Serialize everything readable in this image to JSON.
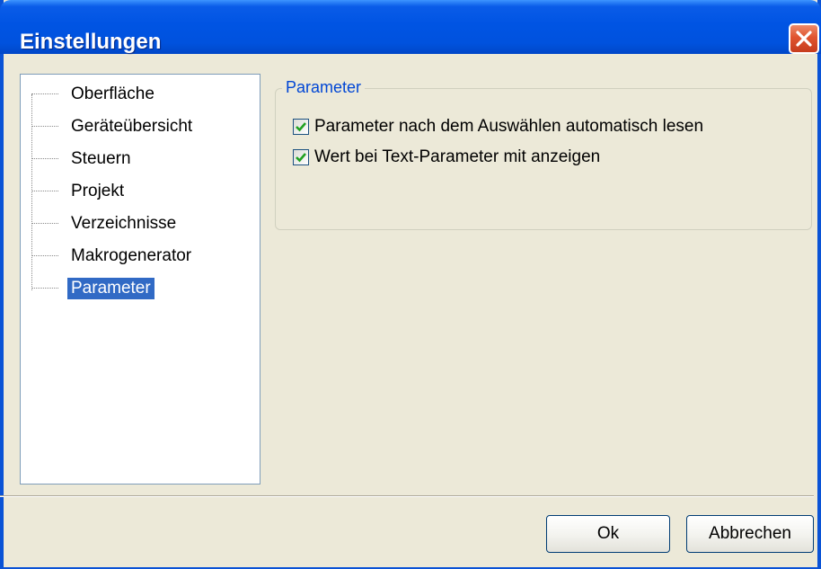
{
  "window": {
    "title": "Einstellungen"
  },
  "tree": {
    "items": [
      {
        "label": "Oberfläche",
        "selected": false
      },
      {
        "label": "Geräteübersicht",
        "selected": false
      },
      {
        "label": "Steuern",
        "selected": false
      },
      {
        "label": "Projekt",
        "selected": false
      },
      {
        "label": "Verzeichnisse",
        "selected": false
      },
      {
        "label": "Makrogenerator",
        "selected": false
      },
      {
        "label": "Parameter",
        "selected": true
      }
    ]
  },
  "panel": {
    "group_title": "Parameter",
    "options": [
      {
        "label": "Parameter nach dem Auswählen automatisch lesen",
        "checked": true
      },
      {
        "label": "Wert bei Text-Parameter mit anzeigen",
        "checked": true
      }
    ]
  },
  "buttons": {
    "ok_label": "Ok",
    "cancel_label": "Abbrechen"
  },
  "colors": {
    "titlebar": "#0054e3",
    "selection": "#316ac5",
    "group_title": "#0046d5",
    "checkmark": "#21a121",
    "dialog_background": "#ece9d8"
  },
  "icons": {
    "close": "close-icon",
    "check": "checkmark-icon"
  }
}
